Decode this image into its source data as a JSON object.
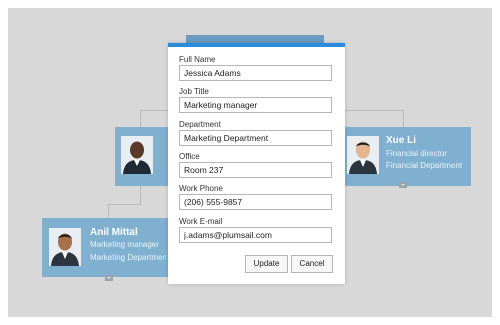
{
  "org_chart": {
    "cards": [
      {
        "name": "",
        "title": "",
        "department": "",
        "avatar_icon": "person-photo-icon"
      },
      {
        "name": "Xue Li",
        "title": "Financial director",
        "department": "Financial Department",
        "avatar_icon": "person-photo-icon"
      },
      {
        "name": "Anil Mittal",
        "title": "Marketing manager",
        "department": "Marketing Department",
        "avatar_icon": "person-photo-icon"
      }
    ]
  },
  "dialog": {
    "fields": [
      {
        "label": "Full Name",
        "value": "Jessica Adams"
      },
      {
        "label": "Job Title",
        "value": "Marketing manager"
      },
      {
        "label": "Department",
        "value": "Marketing Department"
      },
      {
        "label": "Office",
        "value": "Room 237"
      },
      {
        "label": "Work Phone",
        "value": "(206) 555-9857"
      },
      {
        "label": "Work E-mail",
        "value": "j.adams@plumsail.com"
      }
    ],
    "update_label": "Update",
    "cancel_label": "Cancel"
  },
  "colors": {
    "card_bg": "#7fb0d0",
    "dialog_accent": "#2a8ddb",
    "canvas_bg": "#d8d8d8"
  }
}
